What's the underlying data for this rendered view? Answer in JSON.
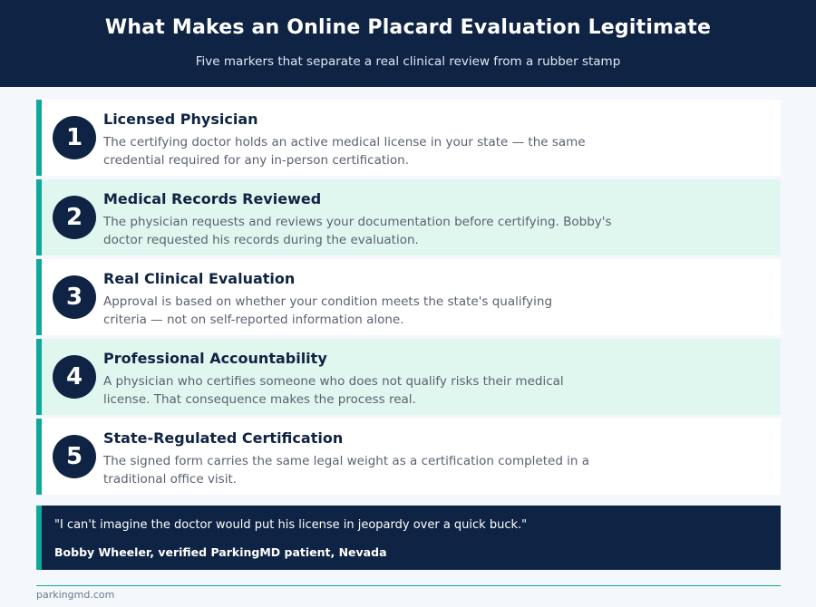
{
  "header": {
    "title": "What Makes an Online Placard Evaluation Legitimate",
    "subtitle": "Five markers that separate a real clinical review from a rubber stamp"
  },
  "markers": [
    {
      "number": "1",
      "title": "Licensed Physician",
      "line1": "The certifying doctor holds an active medical license in your state — the same",
      "line2": "credential required for any in-person certification."
    },
    {
      "number": "2",
      "title": "Medical Records Reviewed",
      "line1": "The physician requests and reviews your documentation before certifying. Bobby's",
      "line2": "doctor requested his records during the evaluation."
    },
    {
      "number": "3",
      "title": "Real Clinical Evaluation",
      "line1": "Approval is based on whether your condition meets the state's qualifying",
      "line2": "criteria — not on self-reported information alone."
    },
    {
      "number": "4",
      "title": "Professional Accountability",
      "line1": "A physician who certifies someone who does not qualify risks their medical",
      "line2": "license. That consequence makes the process real."
    },
    {
      "number": "5",
      "title": "State-Regulated Certification",
      "line1": "The signed form carries the same legal weight as a certification completed in a",
      "line2": "traditional office visit."
    }
  ],
  "quote": {
    "text": "\"I can't imagine the doctor would put his license in jeopardy over a quick buck.\"",
    "attribution": "Bobby Wheeler, verified ParkingMD patient, Nevada"
  },
  "footer": {
    "site": "parkingmd.com"
  }
}
